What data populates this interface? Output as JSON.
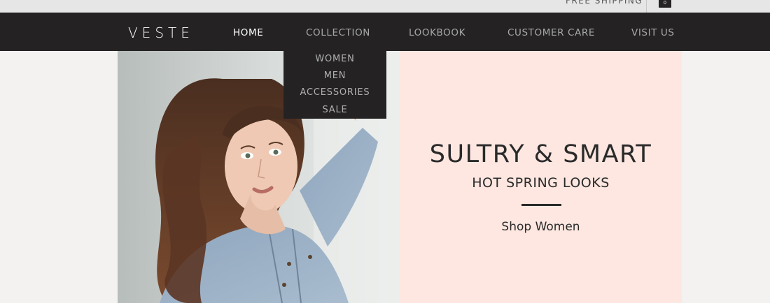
{
  "topbar": {
    "shipping_text": "FREE SHIPPING",
    "cart_count": "0"
  },
  "nav": {
    "logo": "VESTE",
    "items": [
      {
        "label": "HOME",
        "active": true
      },
      {
        "label": "COLLECTION",
        "active": false
      },
      {
        "label": "LOOKBOOK",
        "active": false
      },
      {
        "label": "CUSTOMER CARE",
        "active": false
      },
      {
        "label": "VISIT US",
        "active": false
      }
    ]
  },
  "dropdown": {
    "items": [
      "WOMEN",
      "MEN",
      "ACCESSORIES",
      "SALE"
    ]
  },
  "hero": {
    "title": "SULTRY & SMART",
    "subtitle": "HOT SPRING LOOKS",
    "cta": "Shop Women",
    "panel_color": "#fde7e0"
  },
  "colors": {
    "nav_bg": "#242222",
    "page_bg": "#f3f2f0",
    "active_nav": "#ffffff",
    "inactive_nav": "#a8a8a8"
  }
}
